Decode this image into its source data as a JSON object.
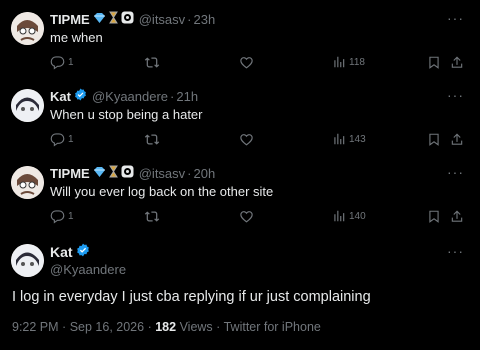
{
  "tweets": [
    {
      "name": "TIPME",
      "handle": "@itsasv",
      "sep": "·",
      "time": "23h",
      "text": "me when",
      "replies": "1",
      "views": "118"
    },
    {
      "name": "Kat",
      "handle": "@Kyaandere",
      "sep": "·",
      "time": "21h",
      "text": "When u stop being a hater",
      "replies": "1",
      "views": "143"
    },
    {
      "name": "TIPME",
      "handle": "@itsasv",
      "sep": "·",
      "time": "20h",
      "text": "Will you ever log back on the other site",
      "replies": "1",
      "views": "140"
    }
  ],
  "main": {
    "name": "Kat",
    "handle": "@Kyaandere",
    "text": "I log in everyday I just cba replying if ur just complaining",
    "time": "9:22 PM",
    "date": "Sep 16, 2026",
    "views_count": "182",
    "views_label": "Views",
    "client": "Twitter for iPhone",
    "sep": "·"
  },
  "more_label": "···",
  "colors": {
    "verified": "#1d9bf0",
    "muted": "#71767b",
    "text": "#e7e9ea",
    "background": "#000000"
  },
  "icons": [
    "reply-icon",
    "retweet-icon",
    "like-icon",
    "views-icon",
    "bookmark-icon",
    "share-icon",
    "verified-icon",
    "diamond-icon",
    "hourglass-icon",
    "record-icon"
  ]
}
